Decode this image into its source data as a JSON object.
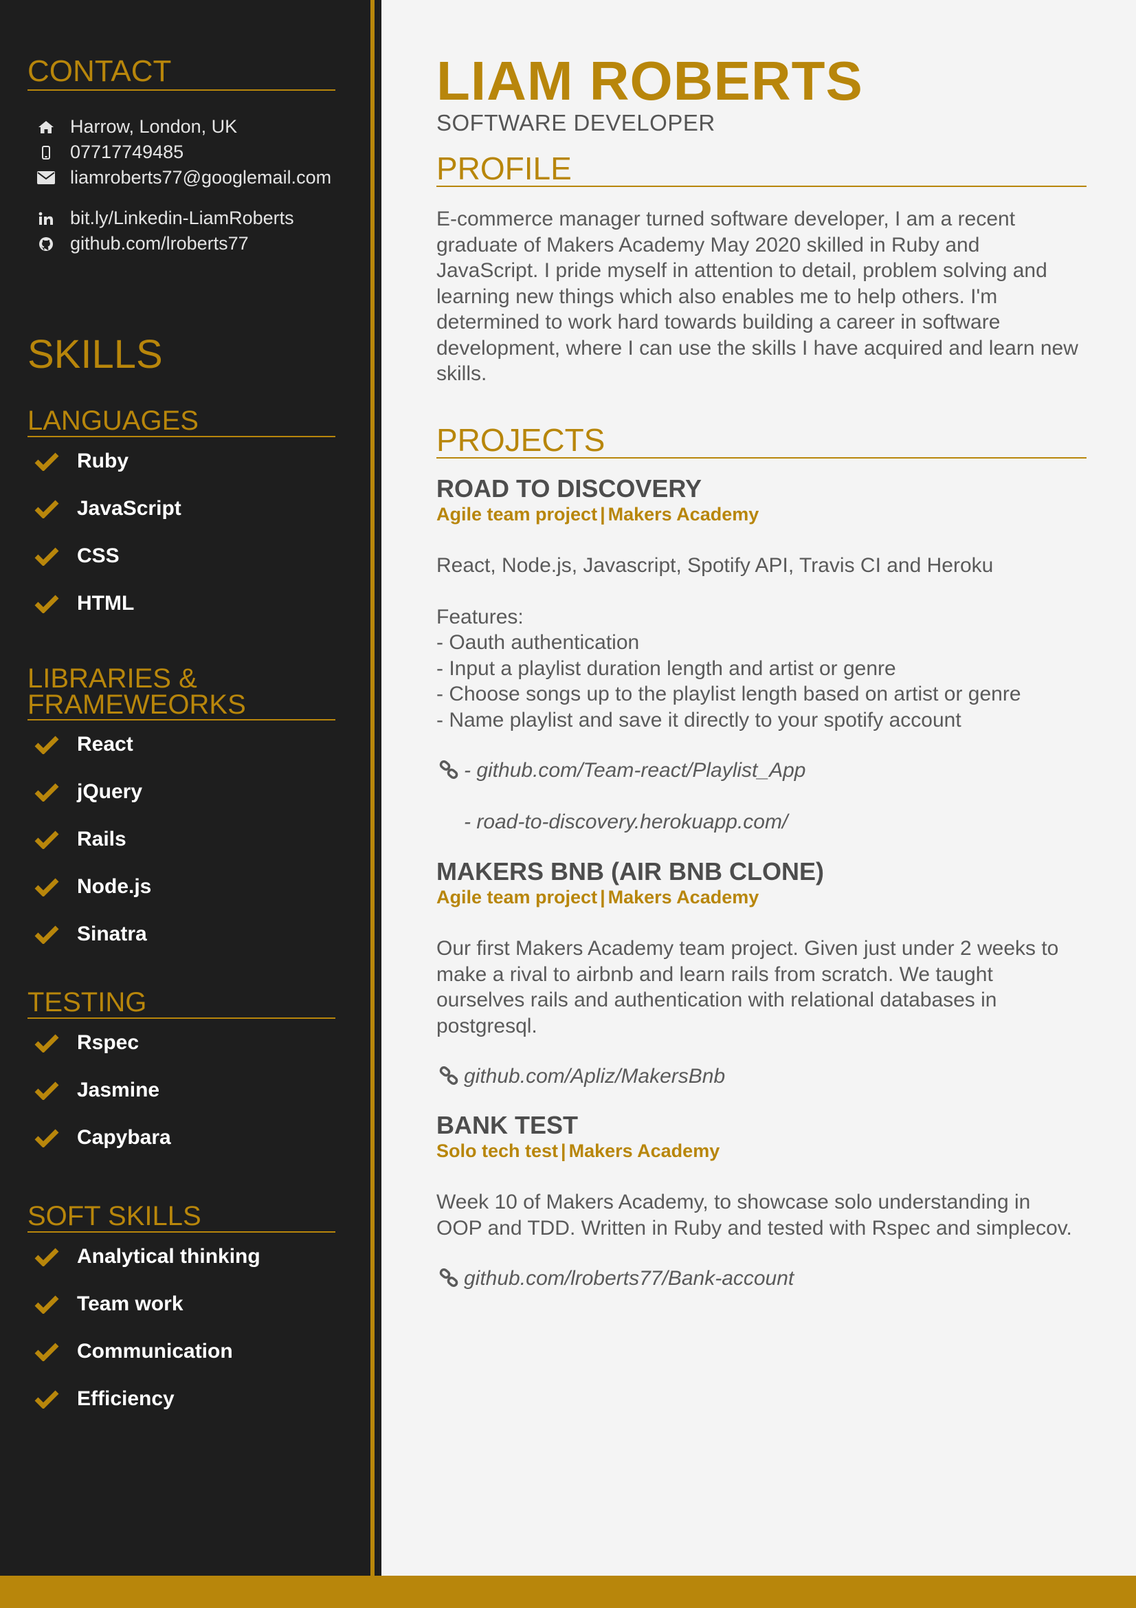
{
  "colors": {
    "accent": "#b8860b",
    "sidebar_bg": "#1e1e1e",
    "page_bg": "#f4f4f4",
    "text": "#555555"
  },
  "sidebar": {
    "contact_heading": "CONTACT",
    "contact": [
      {
        "icon": "home-icon",
        "text": "Harrow, London, UK"
      },
      {
        "icon": "mobile-icon",
        "text": "07717749485"
      },
      {
        "icon": "envelope-icon",
        "text": "liamroberts77@googlemail.com"
      },
      {
        "icon": "linkedin-icon",
        "text": "bit.ly/Linkedin-LiamRoberts"
      },
      {
        "icon": "github-icon",
        "text": "github.com/lroberts77"
      }
    ],
    "skills_heading": "SKILLS",
    "sections": [
      {
        "heading": "LANGUAGES",
        "items": [
          "Ruby",
          "JavaScript",
          "CSS",
          "HTML"
        ]
      },
      {
        "heading_line1": "LIBRARIES &",
        "heading_line2": "FRAMEWEORKS",
        "items": [
          "React",
          "jQuery",
          "Rails",
          "Node.js",
          "Sinatra"
        ]
      },
      {
        "heading": "TESTING",
        "items": [
          "Rspec",
          "Jasmine",
          "Capybara"
        ]
      },
      {
        "heading": "SOFT SKILLS",
        "items": [
          "Analytical thinking",
          "Team work",
          "Communication",
          "Efficiency"
        ]
      }
    ]
  },
  "main": {
    "first_name": "LIAM",
    "last_name": "ROBERTS",
    "title": "SOFTWARE DEVELOPER",
    "profile_heading": "PROFILE",
    "profile": [
      "E-commerce manager turned software developer, I am a recent",
      "graduate of Makers Academy May 2020 skilled in Ruby and",
      "JavaScript. I pride myself in attention to detail, problem solving and",
      "learning new things which also enables me to help others. I'm",
      "determined to work hard towards building a career in software",
      "development, where I can use the skills I have acquired and learn new",
      "skills."
    ],
    "projects_heading": "PROJECTS",
    "projects": [
      {
        "title": "ROAD TO DISCOVERY",
        "type": "Agile team project",
        "org": "Makers Academy",
        "stack": "React, Node.js, Javascript, Spotify API, Travis CI and Heroku",
        "features_label": "Features:",
        "features": [
          "- Oauth authentication",
          "- Input a playlist duration length and artist or genre",
          "- Choose songs up to the playlist length based on artist or genre",
          "- Name playlist and save it directly to your spotify account"
        ],
        "link1": "- github.com/Team-react/Playlist_App",
        "link2": "- road-to-discovery.herokuapp.com/"
      },
      {
        "title": "MAKERS BNB (AIR BNB CLONE)",
        "type": "Agile team project",
        "org": "Makers Academy",
        "description": [
          "Our first Makers Academy team project. Given just under 2 weeks to",
          "make a rival to airbnb and learn rails from scratch. We taught",
          "ourselves rails and authentication with relational databases in",
          "postgresql."
        ],
        "link1": "github.com/Apliz/MakersBnb"
      },
      {
        "title": "BANK TEST",
        "type": "Solo tech test",
        "org": "Makers Academy",
        "description": [
          "Week 10 of Makers Academy, to showcase solo understanding in",
          "OOP and TDD. Written in Ruby and tested with Rspec and simplecov."
        ],
        "link1": "github.com/lroberts77/Bank-account"
      }
    ]
  }
}
